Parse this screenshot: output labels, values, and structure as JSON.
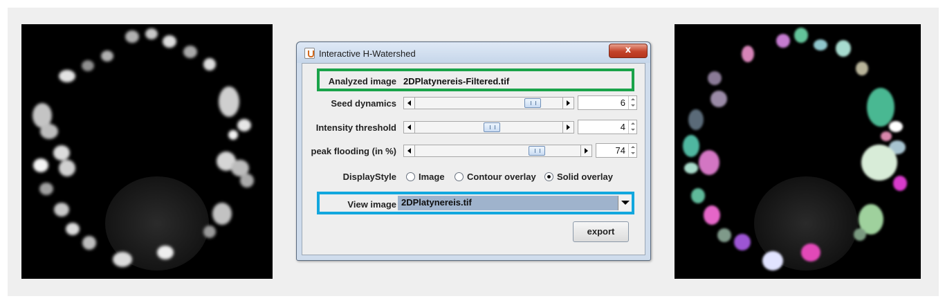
{
  "dialog": {
    "title": "Interactive H-Watershed",
    "close_glyph": "x",
    "analyzed_image_label": "Analyzed image",
    "analyzed_image_value": "2DPlatynereis-Filtered.tif",
    "seed_dynamics_label": "Seed dynamics",
    "seed_dynamics_value": "6",
    "seed_dynamics_level": 0.8,
    "intensity_threshold_label": "Intensity threshold",
    "intensity_threshold_value": "4",
    "intensity_threshold_level": 0.52,
    "peak_flooding_label": "peak flooding (in %)",
    "peak_flooding_value": "74",
    "peak_flooding_level": 0.74,
    "display_style_label": "DisplayStyle",
    "display_options": [
      "Image",
      "Contour overlay",
      "Solid overlay"
    ],
    "display_selected": "Solid overlay",
    "view_image_label": "View image",
    "view_image_value": "2DPlatynereis.tif",
    "export_label": "export"
  },
  "colors": {
    "highlight_green": "#1aa34a",
    "highlight_blue": "#12a7de"
  },
  "icons": [
    "java-cup-icon",
    "close-icon",
    "chevron-down-icon"
  ]
}
